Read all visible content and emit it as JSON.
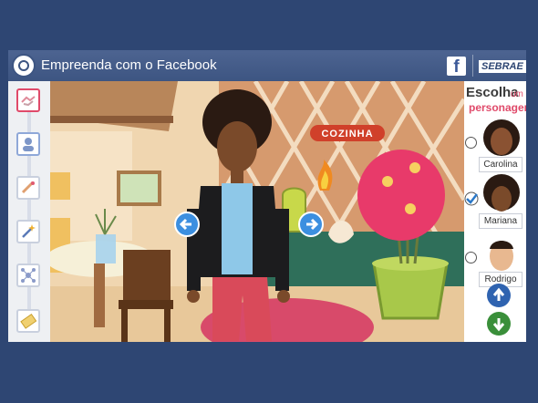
{
  "window": {
    "title": "Empreenda com o Facebook",
    "facebook_glyph": "f",
    "brand": "SEBRAE"
  },
  "steps": [
    {
      "icon": "handshake-icon"
    },
    {
      "icon": "person-icon"
    },
    {
      "icon": "certificate-icon"
    },
    {
      "icon": "magic-wand-icon"
    },
    {
      "icon": "network-icon"
    },
    {
      "icon": "ticket-icon"
    }
  ],
  "scene": {
    "sign": "COZINHA"
  },
  "panel": {
    "heading_a": "Escolha",
    "heading_b": "um",
    "heading_c": "personagem",
    "characters": [
      {
        "name": "Carolina",
        "selected": false
      },
      {
        "name": "Mariana",
        "selected": true
      },
      {
        "name": "Rodrigo",
        "selected": false
      }
    ]
  },
  "colors": {
    "accent": "#e04a6a",
    "titlebar": "#3d5582",
    "up_button": "#2f63b0",
    "down_button": "#3a8f3a"
  }
}
